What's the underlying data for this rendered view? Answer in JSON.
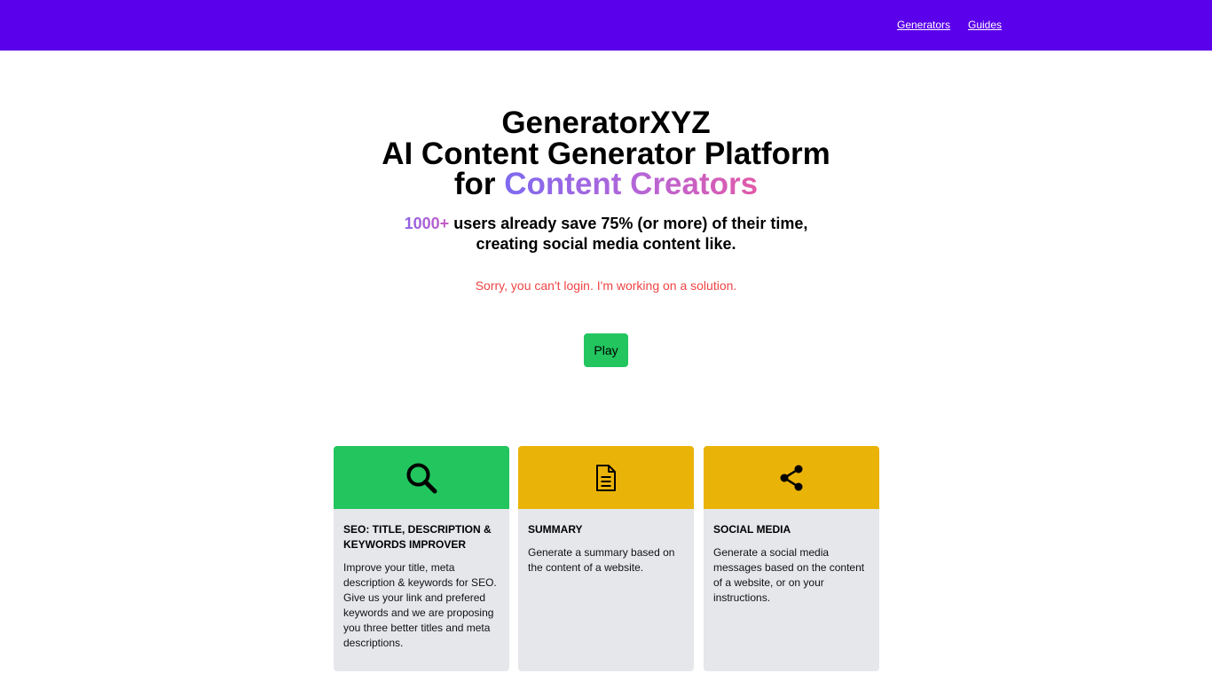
{
  "nav": {
    "generators_label": "Generators",
    "guides_label": "Guides"
  },
  "hero": {
    "line1": "GeneratorXYZ",
    "line2": "AI Content Generator Platform",
    "line3_prefix": "for",
    "line3_highlight": "Content Creators",
    "users_count": "1000+",
    "subtitle_rest": "users already save 75% (or more) of their time,",
    "subtitle_line2": "creating social media content like.",
    "notice": "Sorry, you can't login. I'm working on a solution.",
    "play_label": "Play"
  },
  "cards": [
    {
      "icon": "search-icon",
      "header_color": "#22c55e",
      "title": "SEO: TITLE, DESCRIPTION & KEYWORDS IMPROVER",
      "description": "Improve your title, meta description & keywords for SEO. Give us your link and prefered keywords and we are proposing you three better titles and meta descriptions."
    },
    {
      "icon": "document-icon",
      "header_color": "#eab308",
      "title": "SUMMARY",
      "description": "Generate a summary based on the content of a website."
    },
    {
      "icon": "share-icon",
      "header_color": "#eab308",
      "title": "SOCIAL MEDIA",
      "description": "Generate a social media messages based on the content of a website, or on your instructions."
    }
  ],
  "colors": {
    "topbar": "#5b00eb",
    "play_button": "#22c55e",
    "notice": "#ef4444",
    "card_background": "#e5e7eb"
  }
}
